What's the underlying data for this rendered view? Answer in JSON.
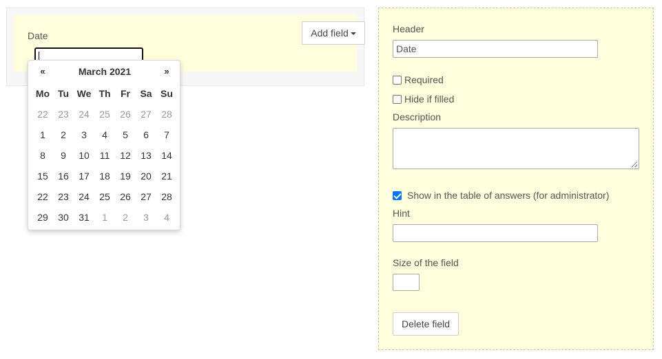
{
  "form": {
    "field_label": "Date",
    "date_value": "",
    "add_field_label": "Add field"
  },
  "datepicker": {
    "prev": "«",
    "next": "»",
    "title": "March 2021",
    "weekdays": [
      "Mo",
      "Tu",
      "We",
      "Th",
      "Fr",
      "Sa",
      "Su"
    ],
    "weeks": [
      [
        {
          "d": "22",
          "old": true
        },
        {
          "d": "23",
          "old": true
        },
        {
          "d": "24",
          "old": true
        },
        {
          "d": "25",
          "old": true
        },
        {
          "d": "26",
          "old": true
        },
        {
          "d": "27",
          "old": true
        },
        {
          "d": "28",
          "old": true
        }
      ],
      [
        {
          "d": "1"
        },
        {
          "d": "2"
        },
        {
          "d": "3"
        },
        {
          "d": "4"
        },
        {
          "d": "5"
        },
        {
          "d": "6"
        },
        {
          "d": "7"
        }
      ],
      [
        {
          "d": "8"
        },
        {
          "d": "9"
        },
        {
          "d": "10"
        },
        {
          "d": "11"
        },
        {
          "d": "12"
        },
        {
          "d": "13"
        },
        {
          "d": "14"
        }
      ],
      [
        {
          "d": "15"
        },
        {
          "d": "16"
        },
        {
          "d": "17"
        },
        {
          "d": "18"
        },
        {
          "d": "19"
        },
        {
          "d": "20"
        },
        {
          "d": "21"
        }
      ],
      [
        {
          "d": "22"
        },
        {
          "d": "23"
        },
        {
          "d": "24"
        },
        {
          "d": "25"
        },
        {
          "d": "26"
        },
        {
          "d": "27"
        },
        {
          "d": "28"
        }
      ],
      [
        {
          "d": "29"
        },
        {
          "d": "30"
        },
        {
          "d": "31"
        },
        {
          "d": "1",
          "old": true
        },
        {
          "d": "2",
          "old": true
        },
        {
          "d": "3",
          "old": true
        },
        {
          "d": "4",
          "old": true
        }
      ]
    ]
  },
  "settings": {
    "header_label": "Header",
    "header_value": "Date",
    "required_label": "Required",
    "required_checked": false,
    "hide_label": "Hide if filled",
    "hide_checked": false,
    "description_label": "Description",
    "description_value": "",
    "show_table_label": "Show in the table of answers (for administrator)",
    "show_table_checked": true,
    "hint_label": "Hint",
    "hint_value": "",
    "size_label": "Size of the field",
    "size_value": "",
    "delete_label": "Delete field"
  },
  "colors": {
    "field_bg": "#ffffdd",
    "check_accent": "#0075ff"
  }
}
